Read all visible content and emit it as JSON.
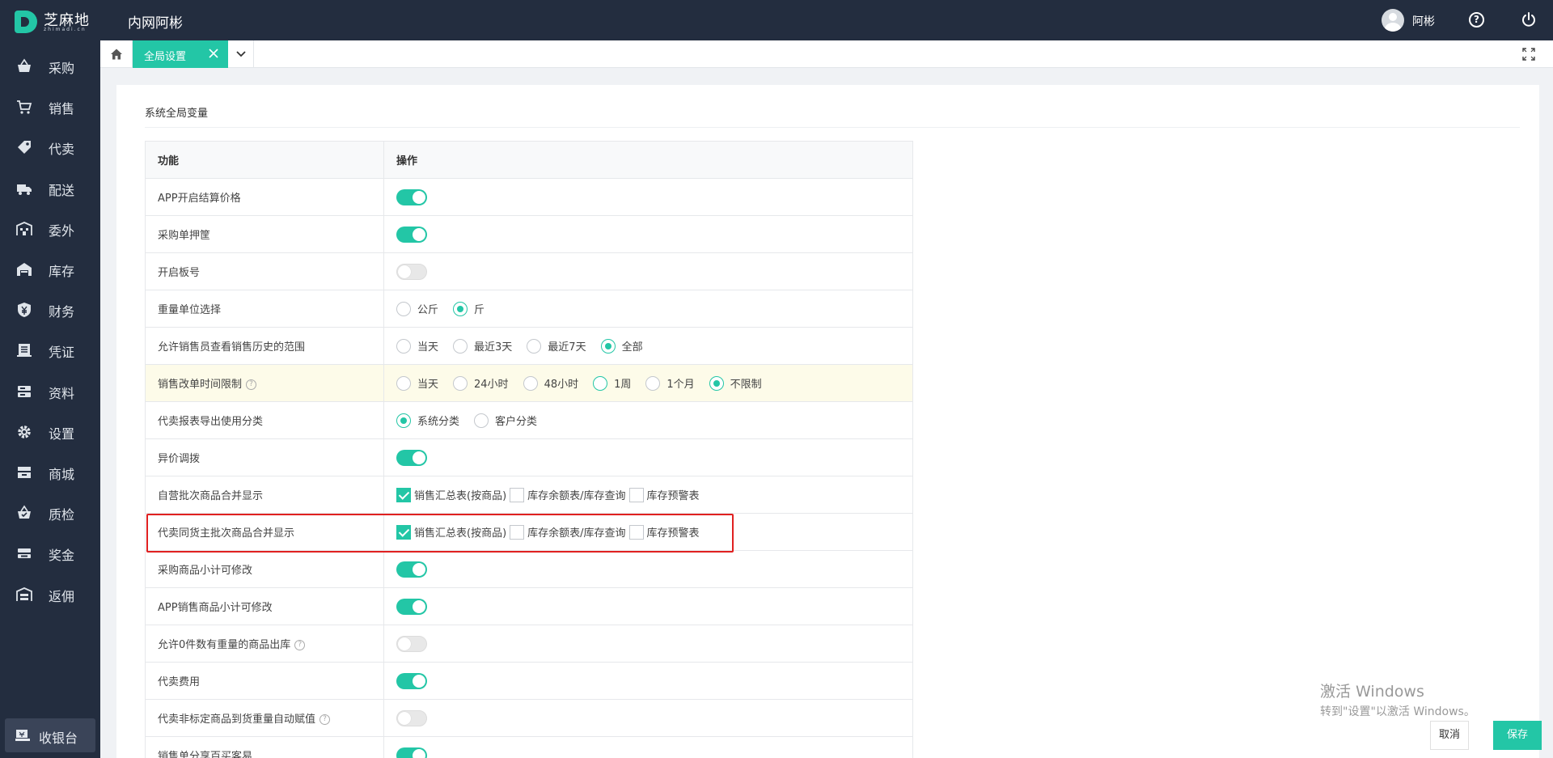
{
  "header": {
    "logo_text": "芝麻地",
    "logo_sub": "zhimadi.cn",
    "app_title": "内网阿彬",
    "user_name": "阿彬"
  },
  "sidebar": {
    "items": [
      {
        "label": "采购",
        "icon": "basket-icon"
      },
      {
        "label": "销售",
        "icon": "cart-icon"
      },
      {
        "label": "代卖",
        "icon": "tag-icon"
      },
      {
        "label": "配送",
        "icon": "truck-icon"
      },
      {
        "label": "委外",
        "icon": "building-icon"
      },
      {
        "label": "库存",
        "icon": "warehouse-icon"
      },
      {
        "label": "财务",
        "icon": "yen-shield-icon"
      },
      {
        "label": "凭证",
        "icon": "voucher-icon"
      },
      {
        "label": "资料",
        "icon": "database-icon"
      },
      {
        "label": "设置",
        "icon": "gear-icon"
      },
      {
        "label": "商城",
        "icon": "store-icon"
      },
      {
        "label": "质检",
        "icon": "basket-check-icon"
      },
      {
        "label": "奖金",
        "icon": "money-icon"
      },
      {
        "label": "返佣",
        "icon": "rebate-icon"
      }
    ],
    "cashier_label": "收银台"
  },
  "tabs": {
    "active_label": "全局设置"
  },
  "content": {
    "section_title": "系统全局变量",
    "columns": [
      "功能",
      "操作"
    ],
    "rows": [
      {
        "label": "APP开启结算价格",
        "type": "switch",
        "on": true
      },
      {
        "label": "采购单押筐",
        "type": "switch",
        "on": true
      },
      {
        "label": "开启板号",
        "type": "switch",
        "on": false
      },
      {
        "label": "重量单位选择",
        "type": "radio",
        "options": [
          "公斤",
          "斤"
        ],
        "selected": 1
      },
      {
        "label": "允许销售员查看销售历史的范围",
        "type": "radio",
        "options": [
          "当天",
          "最近3天",
          "最近7天",
          "全部"
        ],
        "selected": 3
      },
      {
        "label": "销售改单时间限制",
        "help": true,
        "highlight": true,
        "type": "radio",
        "options": [
          "当天",
          "24小时",
          "48小时",
          "1周",
          "1个月",
          "不限制"
        ],
        "selected": 5,
        "ring": 3
      },
      {
        "label": "代卖报表导出使用分类",
        "type": "radio",
        "options": [
          "系统分类",
          "客户分类"
        ],
        "selected": 0
      },
      {
        "label": "异价调拨",
        "type": "switch",
        "on": true
      },
      {
        "label": "自营批次商品合并显示",
        "type": "check",
        "options": [
          "销售汇总表(按商品)",
          "库存余额表/库存查询",
          "库存预警表"
        ],
        "checked": [
          0
        ]
      },
      {
        "label": "代卖同货主批次商品合并显示",
        "type": "check",
        "options": [
          "销售汇总表(按商品)",
          "库存余额表/库存查询",
          "库存预警表"
        ],
        "checked": [
          0
        ]
      },
      {
        "label": "采购商品小计可修改",
        "type": "switch",
        "on": true
      },
      {
        "label": "APP销售商品小计可修改",
        "type": "switch",
        "on": true
      },
      {
        "label": "允许0件数有重量的商品出库",
        "help": true,
        "type": "switch",
        "on": false
      },
      {
        "label": "代卖费用",
        "type": "switch",
        "on": true
      },
      {
        "label": "代卖非标定商品到货重量自动赋值",
        "help": true,
        "type": "switch",
        "on": false
      },
      {
        "label": "销售单分享百买客易",
        "type": "switch",
        "on": true
      }
    ]
  },
  "watermark": {
    "title": "激活 Windows",
    "subtitle": "转到\"设置\"以激活 Windows。"
  },
  "footer": {
    "cancel_label": "取消",
    "save_label": "保存"
  },
  "colors": {
    "accent": "#23c6a6",
    "sidebar_bg": "#232d3f",
    "highlight_border": "#e02020"
  }
}
